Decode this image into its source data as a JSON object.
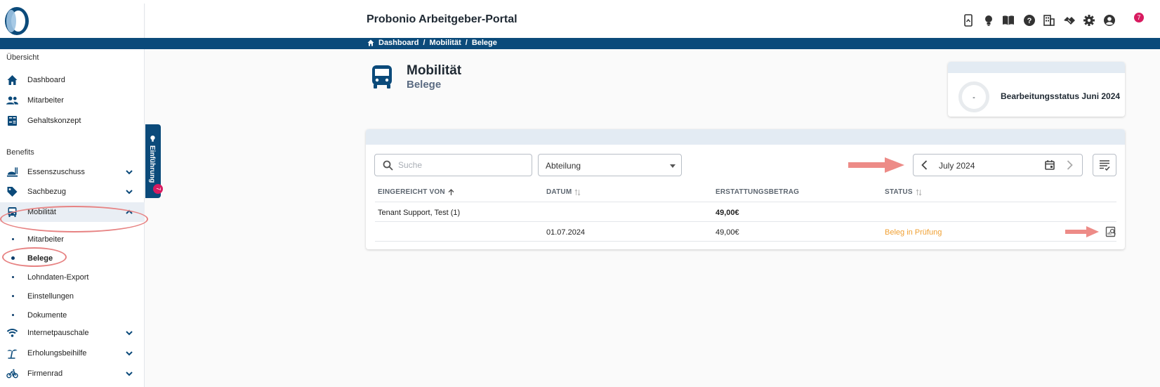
{
  "app": {
    "title": "Probonio Arbeitgeber-Portal",
    "notification_count": "7"
  },
  "header_icons": [
    "phone-icon",
    "lightbulb-icon",
    "book-icon",
    "help-icon",
    "building-icon",
    "handshake-icon",
    "gear-icon",
    "account-icon"
  ],
  "breadcrumb": [
    "Dashboard",
    "/",
    "Mobilität",
    "/",
    "Belege"
  ],
  "sidebar": {
    "section_overview": "Übersicht",
    "overview_items": [
      {
        "label": "Dashboard",
        "icon": "home-icon"
      },
      {
        "label": "Mitarbeiter",
        "icon": "people-icon"
      },
      {
        "label": "Gehaltskonzept",
        "icon": "calculator-icon"
      }
    ],
    "section_benefits": "Benefits",
    "benefit_items": [
      {
        "label": "Essenszuschuss",
        "icon": "meal-icon"
      },
      {
        "label": "Sachbezug",
        "icon": "tag-icon"
      },
      {
        "label": "Mobilität",
        "icon": "bus-icon"
      }
    ],
    "mobility_sub": [
      "Mitarbeiter",
      "Belege",
      "Lohndaten-Export",
      "Einstellungen",
      "Dokumente"
    ],
    "more_items": [
      {
        "label": "Internetpauschale",
        "icon": "wifi-icon"
      },
      {
        "label": "Erholungsbeihilfe",
        "icon": "palm-icon"
      },
      {
        "label": "Firmenrad",
        "icon": "bike-icon"
      }
    ]
  },
  "intro_tab": {
    "label": "Einführung",
    "badge": "7"
  },
  "page": {
    "title": "Mobilität",
    "subtitle": "Belege"
  },
  "status_card": {
    "value": "-",
    "label": "Bearbeitungsstatus Juni 2024"
  },
  "filters": {
    "search_placeholder": "Suche",
    "department": "Abteilung",
    "month": "July 2024"
  },
  "table": {
    "headers": [
      "EINGEREICHT VON",
      "DATUM",
      "ERSTATTUNGSBETRAG",
      "STATUS"
    ],
    "group_row": {
      "name": "Tenant Support, Test (1)",
      "amount": "49,00€"
    },
    "rows": [
      {
        "date": "01.07.2024",
        "amount": "49,00€",
        "status": "Beleg in Prüfung"
      }
    ]
  },
  "colors": {
    "primary": "#0b4a7a",
    "status_pending": "#f0a033",
    "badge": "#d81b60",
    "annotation": "#e78383"
  }
}
